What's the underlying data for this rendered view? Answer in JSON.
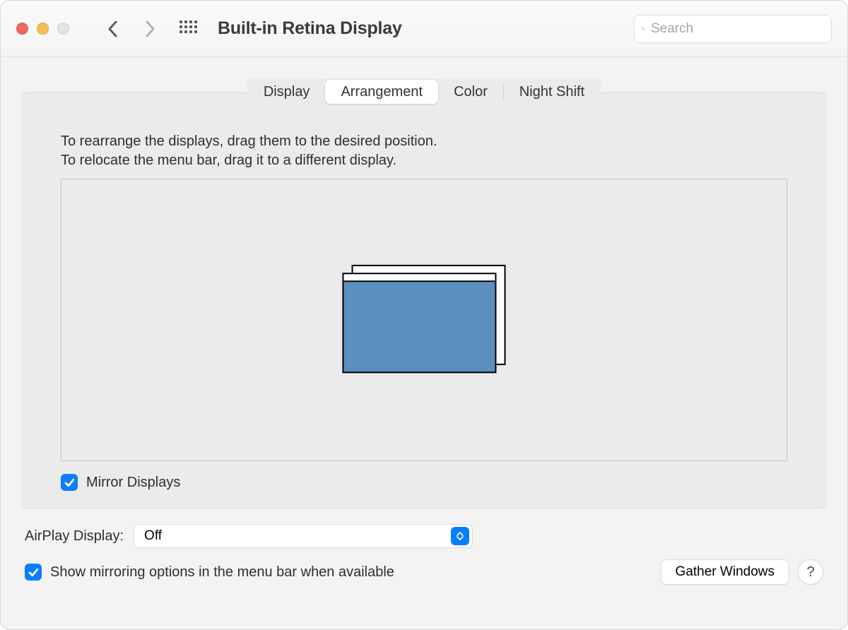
{
  "window": {
    "title": "Built-in Retina Display"
  },
  "search": {
    "placeholder": "Search"
  },
  "tabs": {
    "display": "Display",
    "arrangement": "Arrangement",
    "color": "Color",
    "night_shift": "Night Shift",
    "active": "arrangement"
  },
  "instructions": {
    "line1": "To rearrange the displays, drag them to the desired position.",
    "line2": "To relocate the menu bar, drag it to a different display."
  },
  "mirror": {
    "label": "Mirror Displays",
    "checked": true
  },
  "airplay": {
    "label": "AirPlay Display:",
    "value": "Off"
  },
  "show_mirroring": {
    "label": "Show mirroring options in the menu bar when available",
    "checked": true
  },
  "buttons": {
    "gather": "Gather Windows",
    "help": "?"
  }
}
